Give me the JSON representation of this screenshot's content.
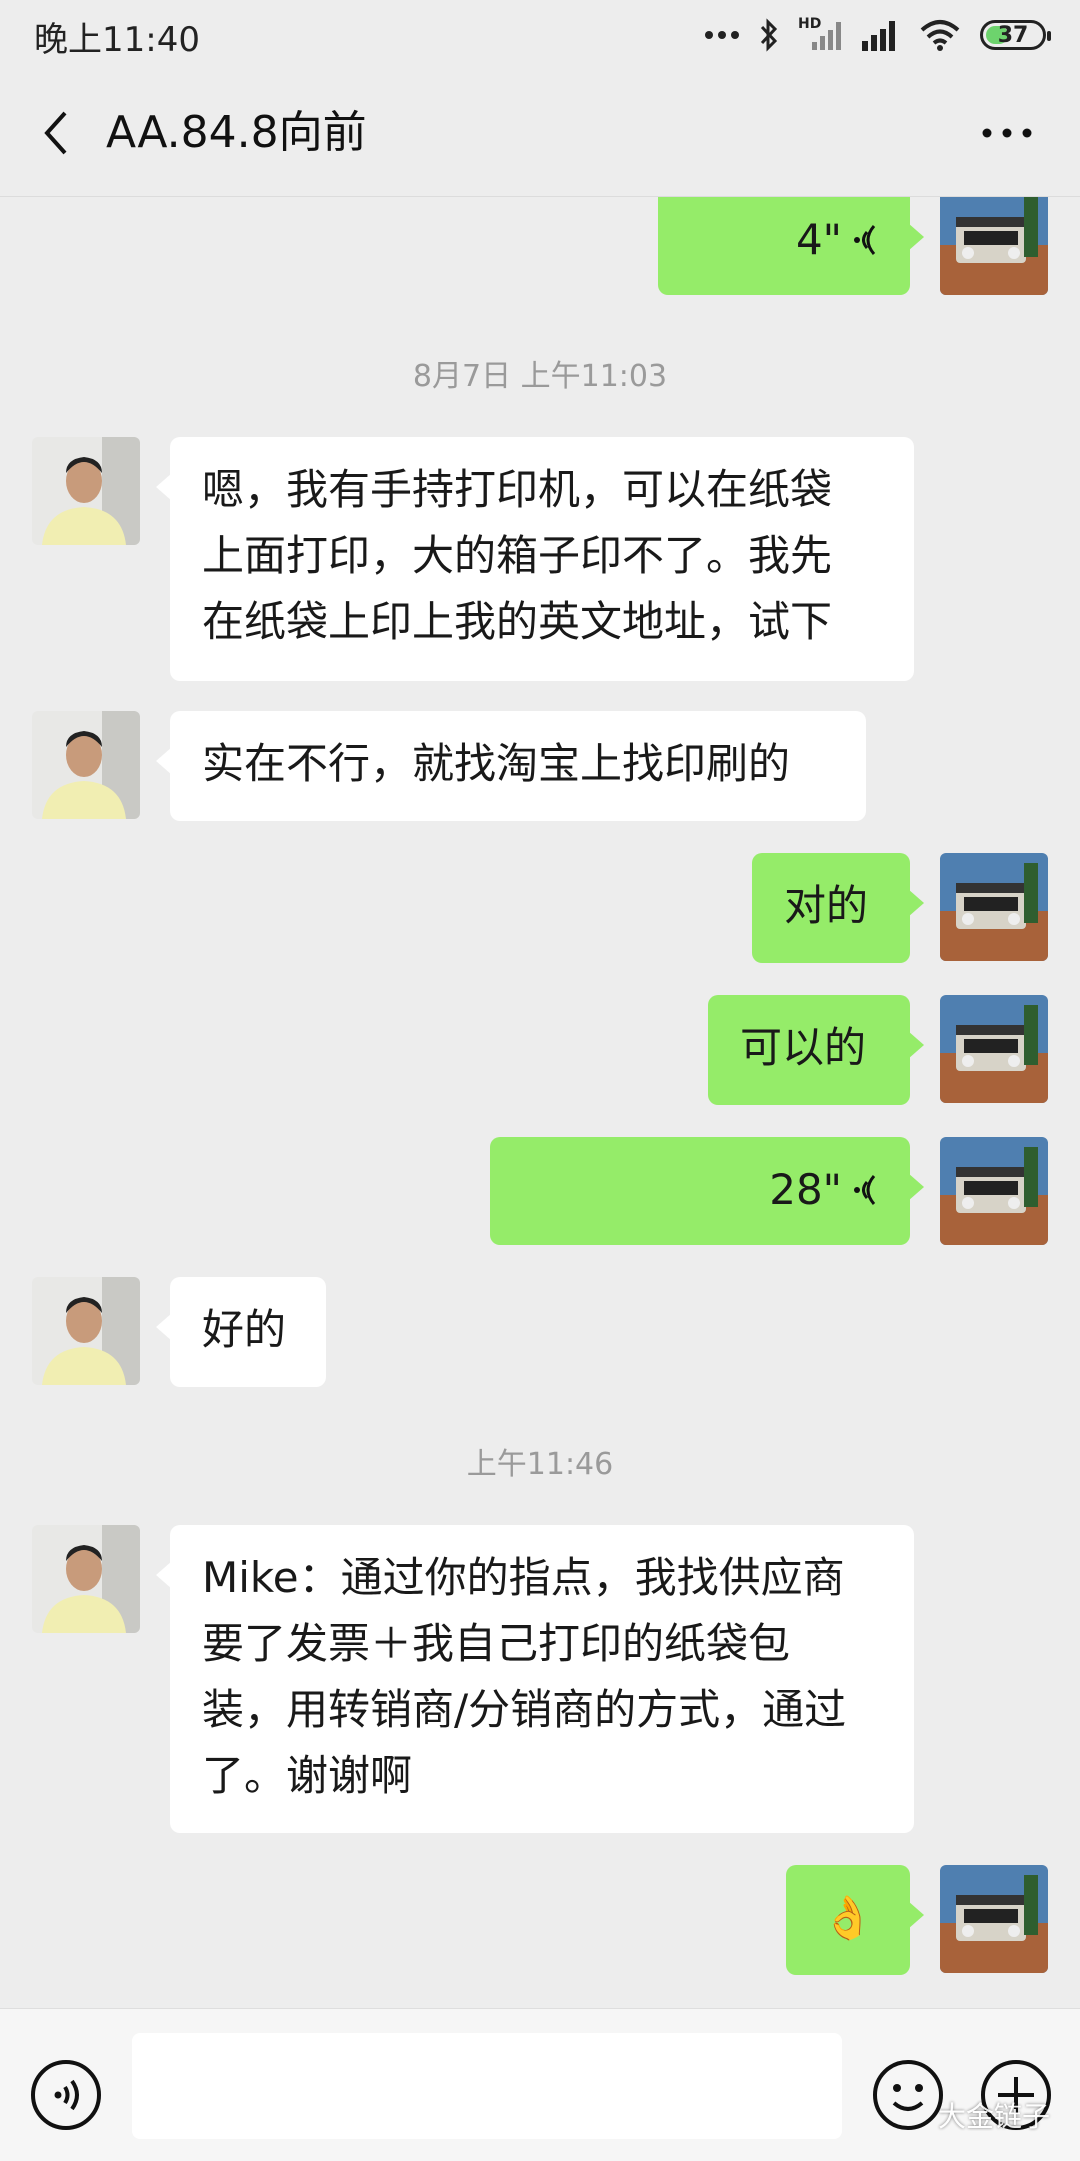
{
  "status_bar": {
    "time": "晚上11:40",
    "battery": "37",
    "network": "HD"
  },
  "header": {
    "title": "AA.84.8向前",
    "back_icon": "chevron-left-icon",
    "more_icon": "more-dots-icon"
  },
  "messages": [
    {
      "side": "out",
      "type": "voice",
      "text": "4\""
    },
    {
      "type": "time",
      "text": "8月7日 上午11:03"
    },
    {
      "side": "in",
      "type": "text",
      "lines": [
        "嗯，我有手持打印机，可以在纸袋",
        "上面打印，大的箱子印不了。我先",
        "在纸袋上印上我的英文地址，试下"
      ]
    },
    {
      "side": "in",
      "type": "text",
      "lines": [
        "实在不行，就找淘宝上找印刷的"
      ]
    },
    {
      "side": "out",
      "type": "text",
      "lines": [
        "对的"
      ]
    },
    {
      "side": "out",
      "type": "text",
      "lines": [
        "可以的"
      ]
    },
    {
      "side": "out",
      "type": "voice",
      "text": "28\""
    },
    {
      "side": "in",
      "type": "text",
      "lines": [
        "好的"
      ]
    },
    {
      "type": "time",
      "text": "上午11:46"
    },
    {
      "side": "in",
      "type": "text",
      "lines": [
        "Mike：通过你的指点，我找供应商",
        "要了发票＋我自己打印的纸袋包",
        "装，用转销商/分销商的方式，通过",
        "了。谢谢啊"
      ]
    },
    {
      "side": "out",
      "type": "emoji",
      "text": "👌"
    }
  ],
  "input_bar": {
    "voice_icon": "voice-toggle-icon",
    "emoji_icon": "emoji-icon",
    "plus_icon": "plus-icon",
    "watermark": "大金链子"
  },
  "colors": {
    "background": "#ededed",
    "outgoing_bubble": "#95ec69",
    "incoming_bubble": "#ffffff",
    "timestamp": "#9a9a9a"
  }
}
